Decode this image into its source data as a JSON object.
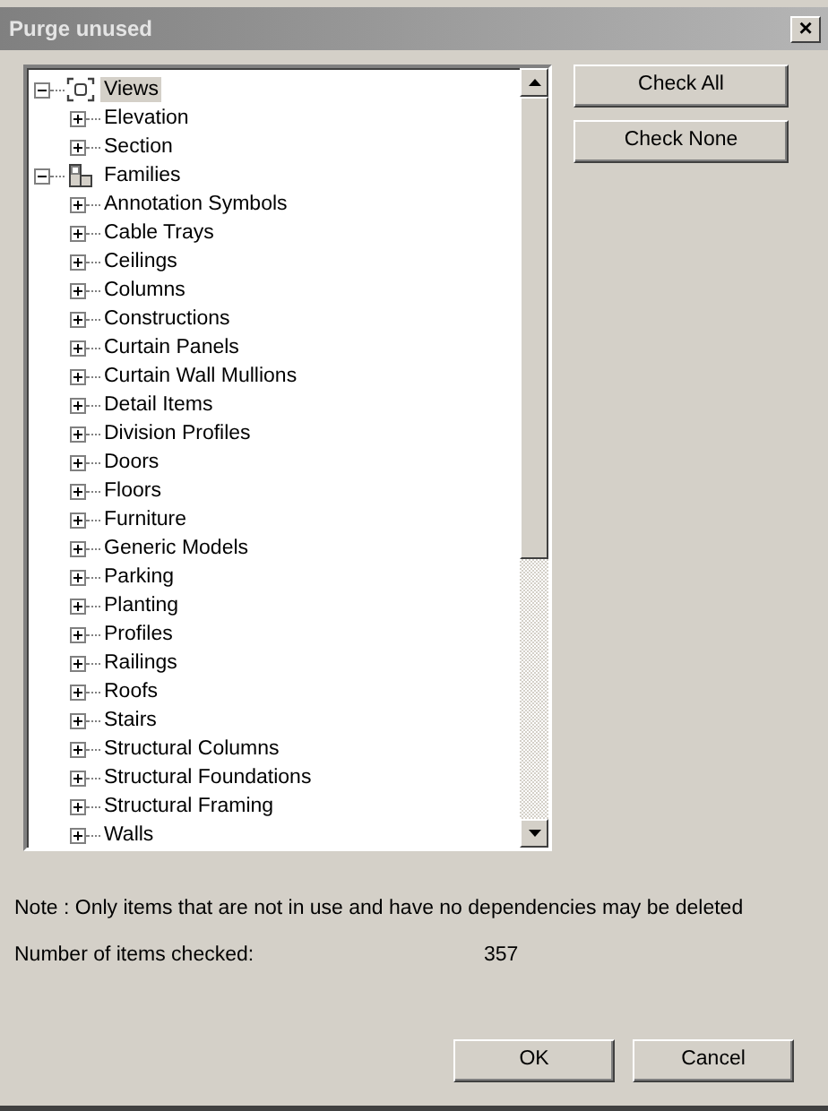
{
  "window": {
    "title": "Purge unused",
    "close": "×"
  },
  "tree": [
    {
      "label": "Views",
      "kind": "views",
      "expanded": true,
      "selected": true,
      "children": [
        {
          "label": "Elevation",
          "expanded": false,
          "selected": false
        },
        {
          "label": "Section",
          "expanded": false,
          "selected": false
        }
      ]
    },
    {
      "label": "Families",
      "kind": "families",
      "expanded": true,
      "selected": false,
      "children": [
        {
          "label": "Annotation Symbols",
          "expanded": false,
          "selected": false
        },
        {
          "label": "Cable Trays",
          "expanded": false,
          "selected": false
        },
        {
          "label": "Ceilings",
          "expanded": false,
          "selected": false
        },
        {
          "label": "Columns",
          "expanded": false,
          "selected": false
        },
        {
          "label": "Constructions",
          "expanded": false,
          "selected": false
        },
        {
          "label": "Curtain Panels",
          "expanded": false,
          "selected": false
        },
        {
          "label": "Curtain Wall Mullions",
          "expanded": false,
          "selected": false
        },
        {
          "label": "Detail Items",
          "expanded": false,
          "selected": false
        },
        {
          "label": "Division Profiles",
          "expanded": false,
          "selected": false
        },
        {
          "label": "Doors",
          "expanded": false,
          "selected": false
        },
        {
          "label": "Floors",
          "expanded": false,
          "selected": false
        },
        {
          "label": "Furniture",
          "expanded": false,
          "selected": false
        },
        {
          "label": "Generic Models",
          "expanded": false,
          "selected": false
        },
        {
          "label": "Parking",
          "expanded": false,
          "selected": false
        },
        {
          "label": "Planting",
          "expanded": false,
          "selected": false
        },
        {
          "label": "Profiles",
          "expanded": false,
          "selected": false
        },
        {
          "label": "Railings",
          "expanded": false,
          "selected": false
        },
        {
          "label": "Roofs",
          "expanded": false,
          "selected": false
        },
        {
          "label": "Stairs",
          "expanded": false,
          "selected": false
        },
        {
          "label": "Structural Columns",
          "expanded": false,
          "selected": false
        },
        {
          "label": "Structural Foundations",
          "expanded": false,
          "selected": false
        },
        {
          "label": "Structural Framing",
          "expanded": false,
          "selected": false
        },
        {
          "label": "Walls",
          "expanded": false,
          "selected": false
        }
      ]
    }
  ],
  "side_buttons": [
    "Check All",
    "Check None"
  ],
  "note": "Note : Only items that are not in use and have no dependencies may be deleted",
  "count": {
    "label": "Number of items checked:",
    "value": "357"
  },
  "buttons": [
    "OK",
    "Cancel"
  ]
}
